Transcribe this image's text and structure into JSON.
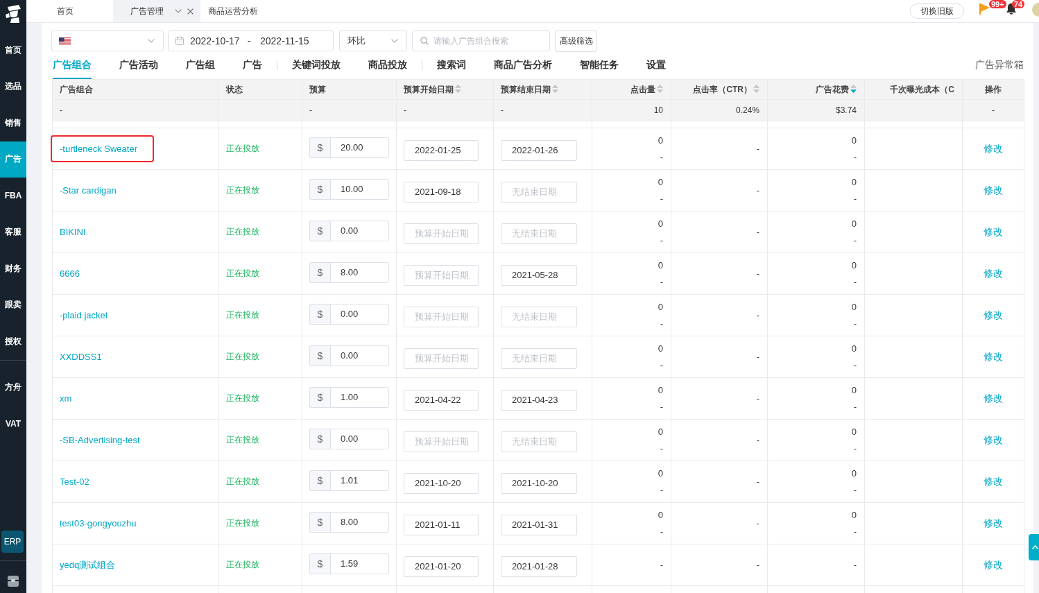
{
  "sidebar": {
    "sections": [
      {
        "items": [
          {
            "label": "首页",
            "selected": false
          },
          {
            "label": "选品",
            "selected": false
          },
          {
            "label": "销售",
            "selected": false
          },
          {
            "label": "广告",
            "selected": true
          },
          {
            "label": "FBA",
            "selected": false
          },
          {
            "label": "客服",
            "selected": false
          },
          {
            "label": "财务",
            "selected": false
          },
          {
            "label": "跟卖",
            "selected": false
          },
          {
            "label": "授权",
            "selected": false
          }
        ]
      },
      {
        "items": [
          {
            "label": "方舟",
            "selected": false
          },
          {
            "label": "VAT",
            "selected": false
          }
        ]
      }
    ],
    "erp_button": "ERP"
  },
  "top_bar": {
    "tabs": [
      {
        "label": "首页",
        "selected": false
      },
      {
        "label": "广告管理",
        "selected": true
      },
      {
        "label": "商品运营分析",
        "selected": false
      }
    ],
    "switch_button": "切换旧版",
    "notifications": [
      {
        "kind": "flag",
        "badge": "99+"
      },
      {
        "kind": "bell",
        "badge": "74"
      }
    ]
  },
  "filters": {
    "date_range": {
      "start": "2022-10-17",
      "separator": "-",
      "end": "2022-11-15"
    },
    "compare_select": "环比",
    "search": {
      "placeholder": "请输入广告组合搜索"
    },
    "advanced_button": "高级筛选"
  },
  "nav": {
    "groups": [
      {
        "tabs": [
          {
            "label": "广告组合",
            "selected": true
          },
          {
            "label": "广告活动",
            "selected": false
          },
          {
            "label": "广告组",
            "selected": false
          },
          {
            "label": "广告",
            "selected": false
          }
        ]
      },
      {
        "tabs": [
          {
            "label": "关键词投放",
            "selected": false
          },
          {
            "label": "商品投放",
            "selected": false
          }
        ]
      },
      {
        "tabs": [
          {
            "label": "搜索词",
            "selected": false
          },
          {
            "label": "商品广告分析",
            "selected": false
          },
          {
            "label": "智能任务",
            "selected": false
          },
          {
            "label": "设置",
            "selected": false
          }
        ]
      }
    ],
    "exception_link": "广告异常箱"
  },
  "table": {
    "columns": [
      {
        "label": "广告组合",
        "kind": "text",
        "sortable": false
      },
      {
        "label": "状态",
        "kind": "text",
        "sortable": false
      },
      {
        "label": "预算",
        "kind": "text",
        "sortable": false
      },
      {
        "label": "预算开始日期",
        "kind": "text",
        "sortable": true,
        "sort_active": false
      },
      {
        "label": "预算结束日期",
        "kind": "text",
        "sortable": true,
        "sort_active": false
      },
      {
        "label": "点击量",
        "kind": "number",
        "sortable": true,
        "sort_active": false
      },
      {
        "label": "点击率（CTR）",
        "kind": "number",
        "sortable": true,
        "sort_active": false
      },
      {
        "label": "广告花费",
        "kind": "number",
        "sortable": true,
        "sort_active": true
      },
      {
        "label": "千次曝光成本（C",
        "kind": "number",
        "sortable": false
      },
      {
        "label": "操作",
        "kind": "action",
        "sortable": false
      }
    ],
    "summary": {
      "name": "-",
      "budget": "-",
      "start_date": "-",
      "end_date": "-",
      "clicks": "10",
      "ctr": "0.24%",
      "spend": "$3.74",
      "action": "-"
    },
    "rows": [
      {
        "name": "-turtleneck Sweater",
        "highlighted": true,
        "status": "正在投放",
        "currency": "$",
        "budget": "20.00",
        "start_date": {
          "value": "2022-01-25"
        },
        "end_date": {
          "value": "2022-01-26"
        },
        "clicks": [
          "0",
          "-"
        ],
        "ctr": "-",
        "spend": [
          "0",
          "-"
        ],
        "action": "修改"
      },
      {
        "name": "-Star cardigan",
        "highlighted": false,
        "status": "正在投放",
        "currency": "$",
        "budget": "10.00",
        "start_date": {
          "value": "2021-09-18"
        },
        "end_date": {
          "placeholder": "无结束日期"
        },
        "clicks": [
          "0",
          "-"
        ],
        "ctr": "-",
        "spend": [
          "0",
          "-"
        ],
        "action": "修改"
      },
      {
        "name": "BIKINI",
        "highlighted": false,
        "status": "正在投放",
        "currency": "$",
        "budget": "0.00",
        "start_date": {
          "placeholder": "预算开始日期"
        },
        "end_date": {
          "placeholder": "无结束日期"
        },
        "clicks": [
          "0",
          "-"
        ],
        "ctr": "-",
        "spend": [
          "0",
          "-"
        ],
        "action": "修改"
      },
      {
        "name": "6666",
        "highlighted": false,
        "status": "正在投放",
        "currency": "$",
        "budget": "8.00",
        "start_date": {
          "placeholder": "预算开始日期"
        },
        "end_date": {
          "value": "2021-05-28"
        },
        "clicks": [
          "0",
          "-"
        ],
        "ctr": "-",
        "spend": [
          "0",
          "-"
        ],
        "action": "修改"
      },
      {
        "name": "-plaid jacket",
        "highlighted": false,
        "status": "正在投放",
        "currency": "$",
        "budget": "0.00",
        "start_date": {
          "placeholder": "预算开始日期"
        },
        "end_date": {
          "placeholder": "无结束日期"
        },
        "clicks": [
          "0",
          "-"
        ],
        "ctr": "-",
        "spend": [
          "0",
          "-"
        ],
        "action": "修改"
      },
      {
        "name": "XXDDSS1",
        "highlighted": false,
        "status": "正在投放",
        "currency": "$",
        "budget": "0.00",
        "start_date": {
          "placeholder": "预算开始日期"
        },
        "end_date": {
          "placeholder": "无结束日期"
        },
        "clicks": [
          "0",
          "-"
        ],
        "ctr": "-",
        "spend": [
          "0",
          "-"
        ],
        "action": "修改"
      },
      {
        "name": "xm",
        "highlighted": false,
        "status": "正在投放",
        "currency": "$",
        "budget": "1.00",
        "start_date": {
          "value": "2021-04-22"
        },
        "end_date": {
          "value": "2021-04-23"
        },
        "clicks": [
          "0",
          "-"
        ],
        "ctr": "-",
        "spend": [
          "0",
          "-"
        ],
        "action": "修改"
      },
      {
        "name": "-SB-Advertising-test",
        "highlighted": false,
        "status": "正在投放",
        "currency": "$",
        "budget": "0.00",
        "start_date": {
          "placeholder": "预算开始日期"
        },
        "end_date": {
          "placeholder": "无结束日期"
        },
        "clicks": [
          "0",
          "-"
        ],
        "ctr": "-",
        "spend": [
          "0",
          "-"
        ],
        "action": "修改"
      },
      {
        "name": "Test-02",
        "highlighted": false,
        "status": "正在投放",
        "currency": "$",
        "budget": "1.01",
        "start_date": {
          "value": "2021-10-20"
        },
        "end_date": {
          "value": "2021-10-20"
        },
        "clicks": [
          "0",
          "-"
        ],
        "ctr": "-",
        "spend": [
          "0",
          "-"
        ],
        "action": "修改"
      },
      {
        "name": "test03-gongyouzhu",
        "highlighted": false,
        "status": "正在投放",
        "currency": "$",
        "budget": "8.00",
        "start_date": {
          "value": "2021-01-11"
        },
        "end_date": {
          "value": "2021-01-31"
        },
        "clicks": [
          "0",
          "-"
        ],
        "ctr": "-",
        "spend": [
          "0",
          "-"
        ],
        "action": "修改"
      },
      {
        "name": "yedq测试组合",
        "highlighted": false,
        "status": "正在投放",
        "currency": "$",
        "budget": "1.59",
        "start_date": {
          "value": "2021-01-20"
        },
        "end_date": {
          "value": "2021-01-28"
        },
        "clicks": [
          "-"
        ],
        "ctr": "-",
        "spend": [
          "-"
        ],
        "action": "修改"
      }
    ]
  }
}
